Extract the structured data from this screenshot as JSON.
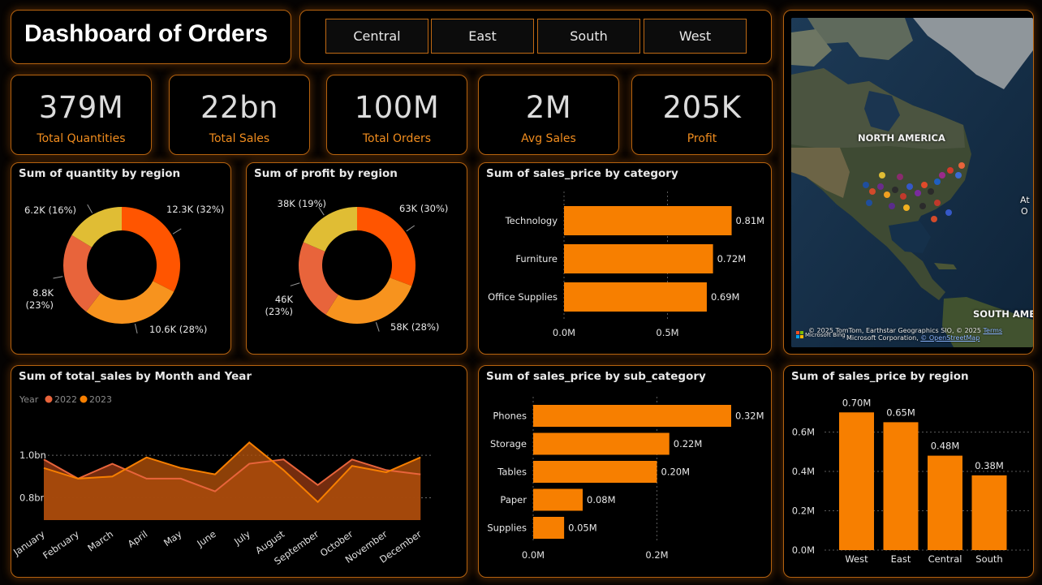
{
  "title": "Dashboard of Orders",
  "region_slicer": [
    "Central",
    "East",
    "South",
    "West"
  ],
  "kpis": [
    {
      "value": "379M",
      "label": "Total Quantities"
    },
    {
      "value": "22bn",
      "label": "Total Sales"
    },
    {
      "value": "100M",
      "label": "Total Orders"
    },
    {
      "value": "2M",
      "label": "Avg Sales"
    },
    {
      "value": "205K",
      "label": "Profit"
    }
  ],
  "colors": {
    "accent": "#f08c1e",
    "bar": "#f77f00",
    "red_orange": "#ff5500",
    "orange": "#f7931e",
    "coral": "#e8643b",
    "yellow": "#e0bd34"
  },
  "map": {
    "labels": {
      "north_america": "NORTH AMERICA",
      "south_america": "SOUTH AME",
      "atlantic_1": "At",
      "atlantic_2": "O"
    },
    "attribution_1": "© 2025 TomTom, Earthstar Geographics SIO, © 2025",
    "attribution_2": "Microsoft Corporation, ",
    "attribution_link": "© OpenStreetMap",
    "terms": "Terms",
    "bing": "Microsoft Bing"
  },
  "chart_data": [
    {
      "id": "qty_by_region",
      "type": "pie",
      "title": "Sum of quantity by region",
      "slices": [
        {
          "label": "12.3K (32%)",
          "value": 12.3,
          "color": "#ff5500"
        },
        {
          "label": "10.6K (28%)",
          "value": 10.6,
          "color": "#f7931e"
        },
        {
          "label": "8.8K (23%)",
          "value": 8.8,
          "color": "#e8643b"
        },
        {
          "label": "6.2K (16%)",
          "value": 6.2,
          "color": "#e0bd34"
        }
      ]
    },
    {
      "id": "profit_by_region",
      "type": "pie",
      "title": "Sum of profit by region",
      "slices": [
        {
          "label": "63K (30%)",
          "value": 63,
          "color": "#ff5500"
        },
        {
          "label": "58K (28%)",
          "value": 58,
          "color": "#f7931e"
        },
        {
          "label": "46K (23%)",
          "value": 46,
          "color": "#e8643b"
        },
        {
          "label": "38K (19%)",
          "value": 38,
          "color": "#e0bd34"
        }
      ]
    },
    {
      "id": "sales_by_category",
      "type": "bar",
      "orientation": "horizontal",
      "title": "Sum of sales_price by category",
      "categories": [
        "Technology",
        "Furniture",
        "Office Supplies"
      ],
      "values": [
        0.81,
        0.72,
        0.69
      ],
      "value_labels": [
        "0.81M",
        "0.72M",
        "0.69M"
      ],
      "ticks": [
        "0.0M",
        "0.5M"
      ],
      "xlim": [
        0,
        1.0
      ]
    },
    {
      "id": "total_sales_by_month",
      "type": "area",
      "title": "Sum of total_sales by Month and Year",
      "legend_title": "Year",
      "categories": [
        "January",
        "February",
        "March",
        "April",
        "May",
        "June",
        "July",
        "August",
        "September",
        "October",
        "November",
        "December"
      ],
      "series": [
        {
          "name": "2022",
          "color": "#e8643b",
          "values": [
            0.98,
            0.89,
            0.96,
            0.89,
            0.89,
            0.83,
            0.96,
            0.98,
            0.86,
            0.98,
            0.93,
            0.91
          ]
        },
        {
          "name": "2023",
          "color": "#f77f00",
          "values": [
            0.94,
            0.89,
            0.9,
            0.99,
            0.94,
            0.91,
            1.06,
            0.93,
            0.78,
            0.95,
            0.92,
            0.99
          ]
        }
      ],
      "yticks": [
        "0.8bn",
        "1.0bn"
      ],
      "ytick_values": [
        0.8,
        1.0
      ],
      "ylim": [
        0.695,
        1.13
      ]
    },
    {
      "id": "sales_by_subcategory",
      "type": "bar",
      "orientation": "horizontal",
      "title": "Sum of sales_price by sub_category",
      "categories": [
        "Phones",
        "Storage",
        "Tables",
        "Paper",
        "Supplies"
      ],
      "values": [
        0.32,
        0.22,
        0.2,
        0.08,
        0.05
      ],
      "value_labels": [
        "0.32M",
        "0.22M",
        "0.20M",
        "0.08M",
        "0.05M"
      ],
      "ticks": [
        "0.0M",
        "0.2M"
      ],
      "xlim": [
        0,
        0.4
      ]
    },
    {
      "id": "sales_by_region",
      "type": "bar",
      "orientation": "vertical",
      "title": "Sum of sales_price by region",
      "categories": [
        "West",
        "East",
        "Central",
        "South"
      ],
      "values": [
        0.7,
        0.65,
        0.48,
        0.38
      ],
      "value_labels": [
        "0.70M",
        "0.65M",
        "0.48M",
        "0.38M"
      ],
      "yticks": [
        "0.0M",
        "0.2M",
        "0.4M",
        "0.6M"
      ],
      "ytick_values": [
        0,
        0.2,
        0.4,
        0.6
      ],
      "ylim": [
        0,
        0.8
      ]
    }
  ]
}
